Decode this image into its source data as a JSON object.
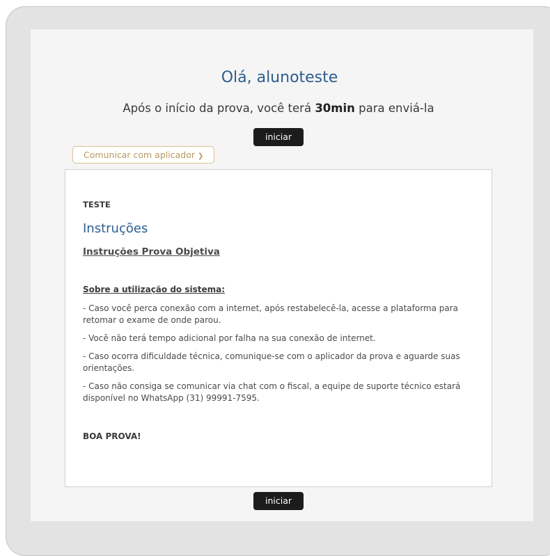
{
  "header": {
    "greeting": "Olá, alunoteste",
    "timer_prefix": "Após o início da prova, você terá",
    "timer_value": "30min",
    "timer_suffix": "para enviá-la"
  },
  "actions": {
    "start_label_top": "iniciar",
    "start_label_bottom": "iniciar",
    "communicate_label": "Comunicar com aplicador",
    "communicate_icon": "chevron-down-icon"
  },
  "instructions": {
    "exam_name": "TESTE",
    "title": "Instruções",
    "subtitle": "Instruções Prova Objetiva",
    "section_heading": "Sobre a utilização do sistema:",
    "paragraphs": [
      "- Caso você perca conexão com a internet, após restabelecê-la, acesse a plataforma para retomar o exame de onde parou.",
      "- Você não terá tempo adicional por falha na sua conexão de internet.",
      "- Caso ocorra dificuldade técnica, comunique-se com o aplicador da prova e aguarde suas orientações.",
      "- Caso não consiga se comunicar via chat com o fiscal, a equipe de suporte técnico estará disponível no WhatsApp (31) 99991-7595."
    ],
    "closing": "BOA PROVA!"
  },
  "colors": {
    "accent_blue": "#2d5d8f",
    "button_dark": "#1c1c1c",
    "communicate_gold": "#b69a5c",
    "frame_gray": "#e3e3e3",
    "screen_bg": "#f5f5f5"
  }
}
